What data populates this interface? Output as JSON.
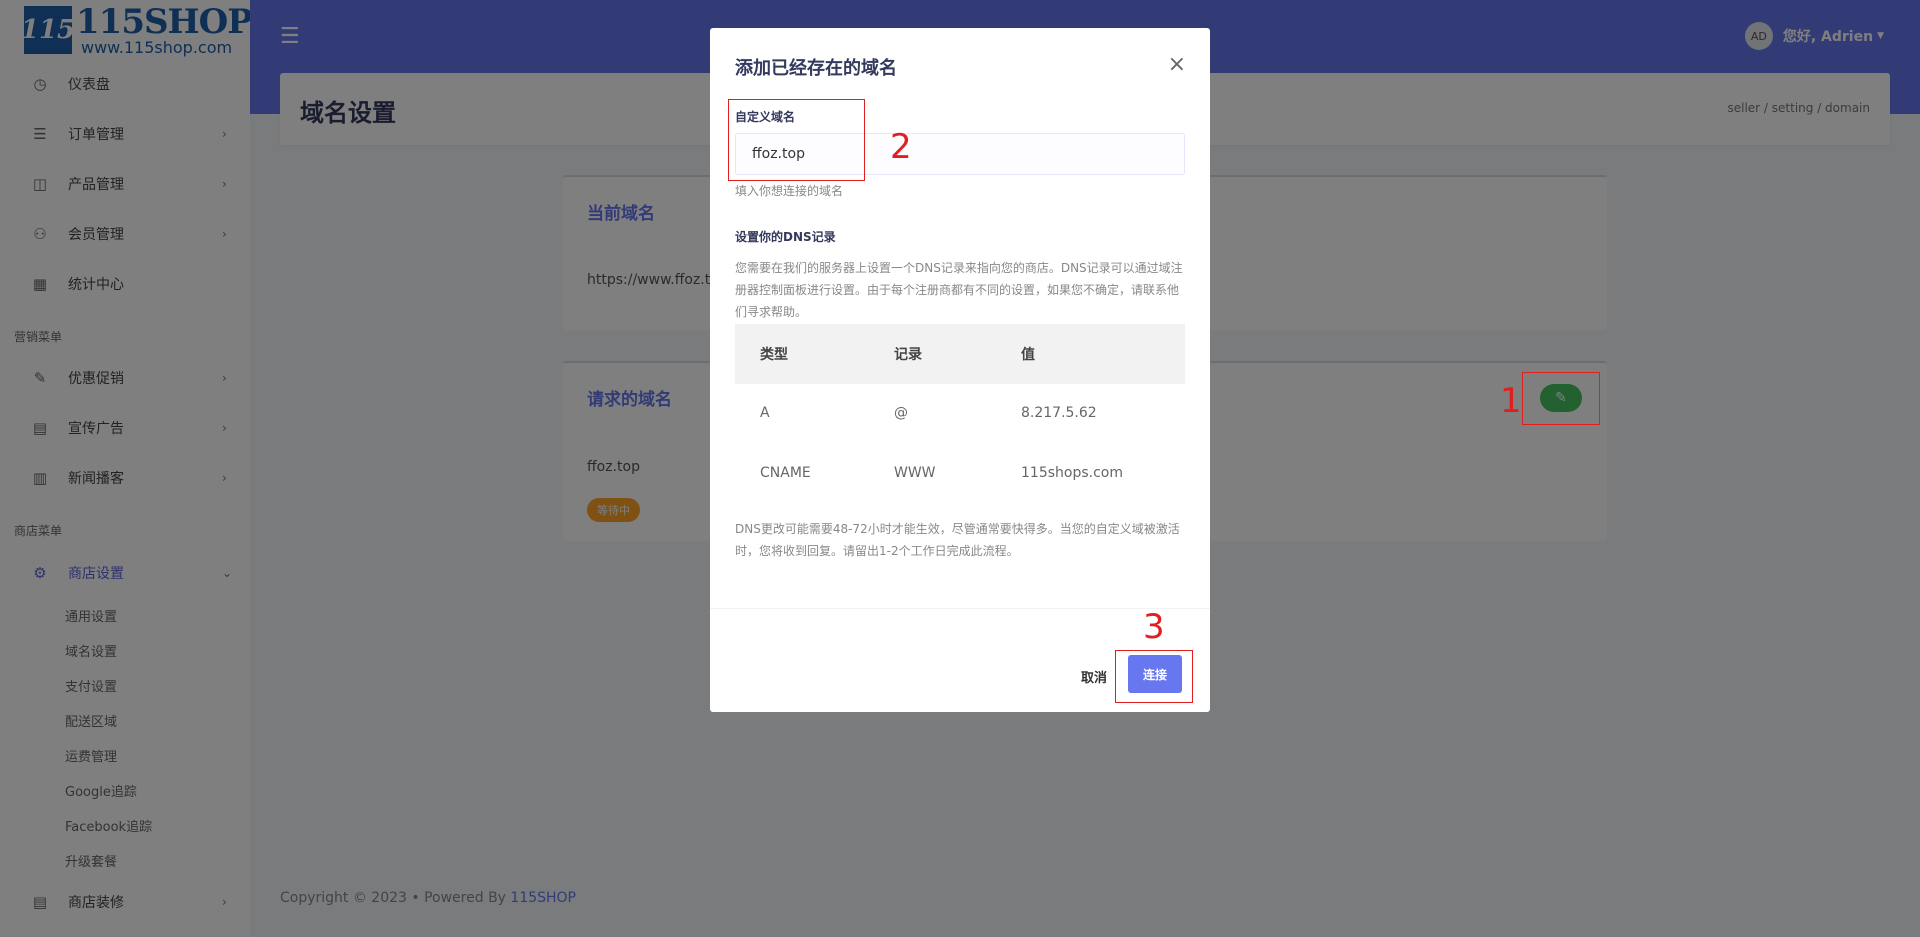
{
  "logo": {
    "mark": "115",
    "name": "115SHOP",
    "url": "www.115shop.com"
  },
  "sidebar": {
    "items": [
      {
        "label": "仪表盘",
        "icon": "dashboard-icon"
      },
      {
        "label": "订单管理",
        "icon": "order-icon"
      },
      {
        "label": "产品管理",
        "icon": "product-icon"
      },
      {
        "label": "会员管理",
        "icon": "users-icon"
      },
      {
        "label": "统计中心",
        "icon": "stats-icon"
      },
      {
        "label": "优惠促销",
        "icon": "promo-icon"
      },
      {
        "label": "宣传广告",
        "icon": "ad-icon"
      },
      {
        "label": "新闻播客",
        "icon": "news-icon"
      },
      {
        "label": "商店设置",
        "icon": "gear-icon"
      },
      {
        "label": "商店装修",
        "icon": "store-icon"
      }
    ],
    "section_marketing": "营销菜单",
    "section_store": "商店菜单",
    "subitems": [
      "通用设置",
      "域名设置",
      "支付设置",
      "配送区域",
      "运费管理",
      "Google追踪",
      "Facebook追踪",
      "升级套餐"
    ]
  },
  "topbar": {
    "avatar": "AD",
    "greeting": "您好, Adrien"
  },
  "page": {
    "title": "域名设置",
    "breadcrumb": "seller  /  setting  /  domain",
    "current_domain_title": "当前域名",
    "current_domain_value": "https://www.ffoz.top",
    "requested_domain_title": "请求的域名",
    "requested_domain_value": "ffoz.top",
    "status_badge": "等待中"
  },
  "modal": {
    "title": "添加已经存在的域名",
    "field_label": "自定义域名",
    "field_value": "ffoz.top",
    "field_help": "填入你想连接的域名",
    "dns_title": "设置你的DNS记录",
    "dns_desc": "您需要在我们的服务器上设置一个DNS记录来指向您的商店。DNS记录可以通过域注册器控制面板进行设置。由于每个注册商都有不同的设置，如果您不确定，请联系他们寻求帮助。",
    "table_headers": [
      "类型",
      "记录",
      "值"
    ],
    "table_rows": [
      [
        "A",
        "@",
        "8.217.5.62"
      ],
      [
        "CNAME",
        "WWW",
        "115shops.com"
      ]
    ],
    "dns_note": "DNS更改可能需要48-72小时才能生效，尽管通常要快得多。当您的自定义域被激活时，您将收到回复。请留出1-2个工作日完成此流程。",
    "cancel_label": "取消",
    "connect_label": "连接"
  },
  "annotations": [
    "1",
    "2",
    "3"
  ],
  "footer": {
    "copyright": "Copyright © 2023  •  Powered By ",
    "brand": "115SHOP"
  },
  "colors": {
    "primary": "#6777ef",
    "success": "#47c363",
    "warning": "#ffa426",
    "annotation": "#e02020"
  }
}
